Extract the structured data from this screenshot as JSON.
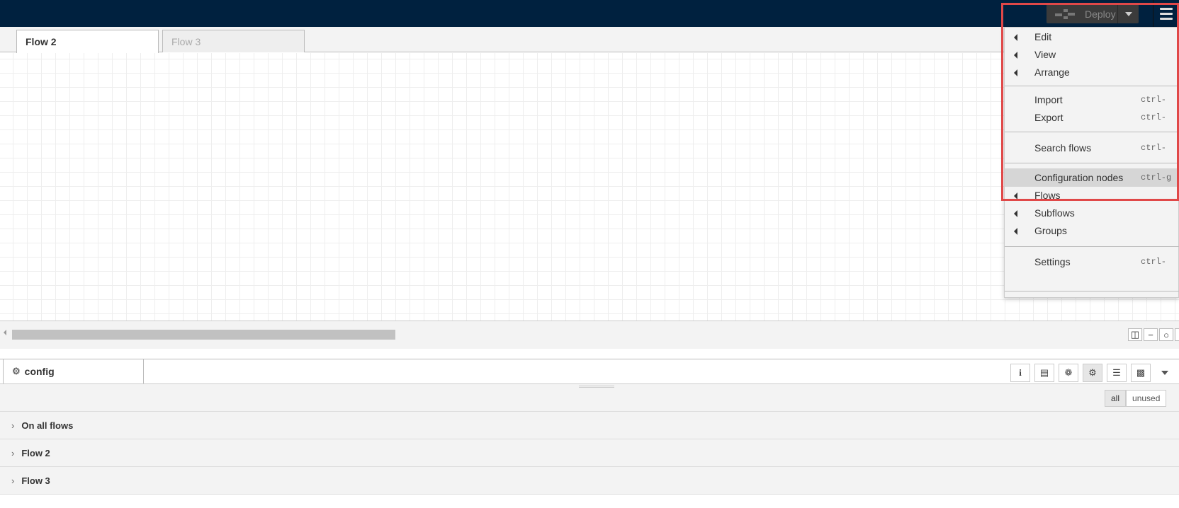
{
  "header": {
    "deploy_label": "Deploy"
  },
  "workspace": {
    "tabs": [
      {
        "label": "Flow 2",
        "active": true
      },
      {
        "label": "Flow 3",
        "active": false
      }
    ],
    "zoom_buttons": [
      "map-icon",
      "zoom-out-icon",
      "zoom-reset-icon",
      "zoom-in-icon"
    ]
  },
  "menu": {
    "items": [
      {
        "label": "Edit",
        "submenu": true,
        "shortcut": ""
      },
      {
        "label": "View",
        "submenu": true,
        "shortcut": ""
      },
      {
        "label": "Arrange",
        "submenu": true,
        "shortcut": ""
      },
      {
        "label": "Import",
        "submenu": false,
        "shortcut": "ctrl-"
      },
      {
        "label": "Export",
        "submenu": false,
        "shortcut": "ctrl-"
      },
      {
        "label": "Search flows",
        "submenu": false,
        "shortcut": "ctrl-"
      },
      {
        "label": "Configuration nodes",
        "submenu": false,
        "shortcut": "ctrl-g",
        "highlighted": true
      },
      {
        "label": "Flows",
        "submenu": true,
        "shortcut": ""
      },
      {
        "label": "Subflows",
        "submenu": true,
        "shortcut": ""
      },
      {
        "label": "Groups",
        "submenu": true,
        "shortcut": ""
      },
      {
        "label": "Settings",
        "submenu": false,
        "shortcut": "ctrl-"
      }
    ]
  },
  "sidebar": {
    "tab_label": "config",
    "tab_icons": [
      "info-icon",
      "book-icon",
      "bug-icon",
      "gear-icon",
      "database-icon",
      "chart-icon"
    ],
    "filter": {
      "all": "all",
      "unused": "unused"
    },
    "sections": [
      {
        "label": "On all flows"
      },
      {
        "label": "Flow 2"
      },
      {
        "label": "Flow 3"
      }
    ]
  },
  "colors": {
    "header_bg": "#00213f",
    "highlight_border": "#e04848"
  }
}
